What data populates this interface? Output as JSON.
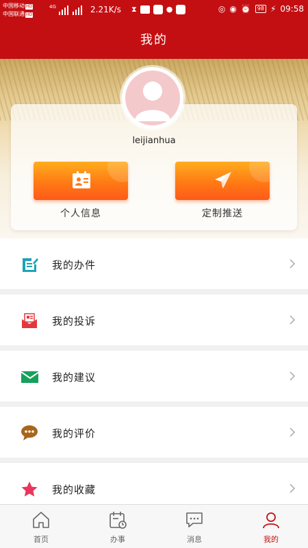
{
  "status_bar": {
    "carrier_1": "中国移动",
    "carrier_2": "中国联通",
    "hd_badge": "HD",
    "network": "4G",
    "speed": "2.21K/s",
    "battery": "98",
    "time": "09:58"
  },
  "header": {
    "title": "我的"
  },
  "profile": {
    "username": "leijianhua",
    "actions": [
      {
        "label": "个人信息",
        "icon": "id-card-icon"
      },
      {
        "label": "定制推送",
        "icon": "paper-plane-icon"
      }
    ]
  },
  "menu": {
    "items": [
      {
        "label": "我的办件",
        "icon": "edit-list-icon"
      },
      {
        "label": "我的投诉",
        "icon": "complaint-mail-icon"
      },
      {
        "label": "我的建议",
        "icon": "envelope-icon"
      },
      {
        "label": "我的评价",
        "icon": "chat-bubble-icon"
      },
      {
        "label": "我的收藏",
        "icon": "star-icon"
      }
    ]
  },
  "tabbar": {
    "tabs": [
      {
        "label": "首页",
        "icon": "home-icon"
      },
      {
        "label": "办事",
        "icon": "calendar-clock-icon"
      },
      {
        "label": "消息",
        "icon": "message-icon"
      },
      {
        "label": "我的",
        "icon": "user-icon",
        "active": true
      }
    ]
  },
  "colors": {
    "brand_red": "#c40f12",
    "action_orange": "#ff7a14",
    "icon_teal": "#1aa3b8",
    "icon_red": "#e2373b",
    "icon_green": "#16a05c",
    "icon_brown": "#a8661b",
    "icon_pink": "#e8375a"
  }
}
